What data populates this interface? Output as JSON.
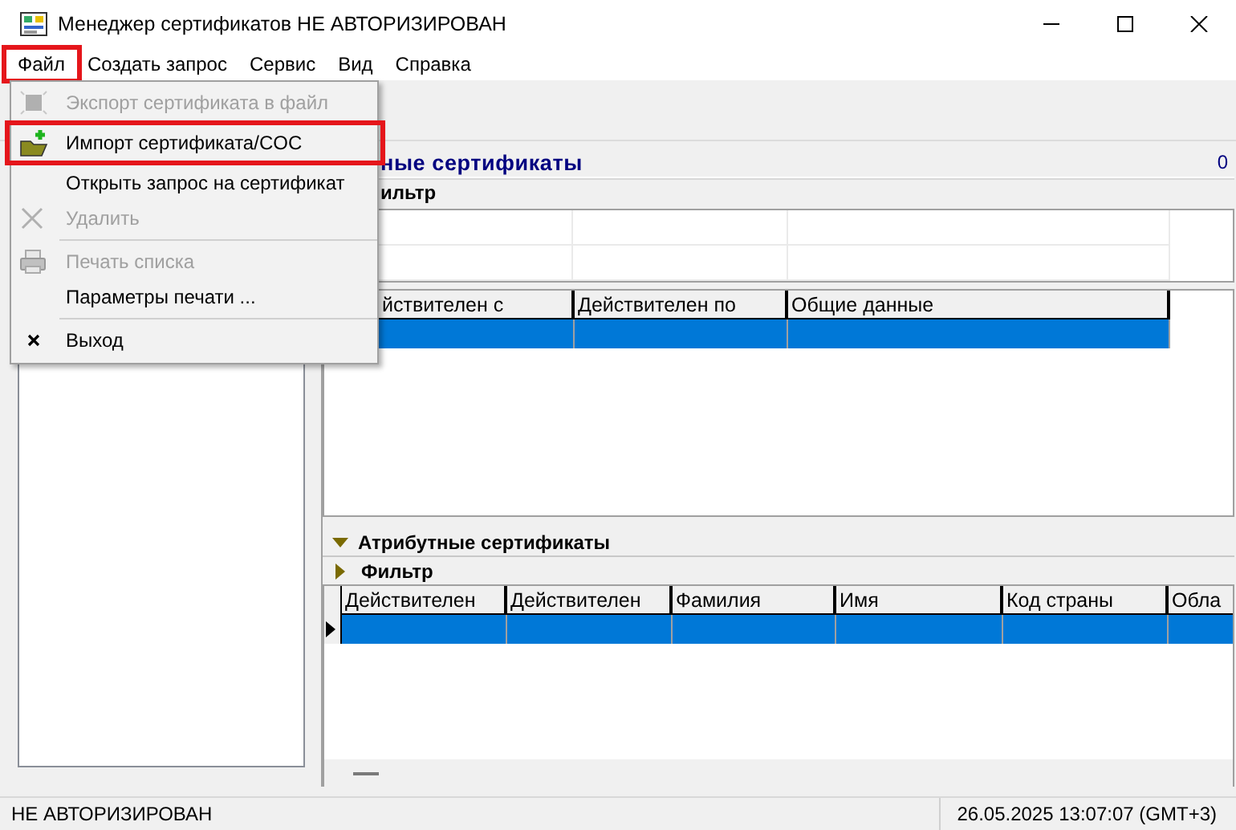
{
  "window": {
    "title": "Менеджер сертификатов  НЕ АВТОРИЗИРОВАН"
  },
  "menu_bar": [
    {
      "label": "Файл",
      "highlighted": true
    },
    {
      "label": "Создать запрос",
      "highlighted": false
    },
    {
      "label": "Сервис",
      "highlighted": false
    },
    {
      "label": "Вид",
      "highlighted": false
    },
    {
      "label": "Справка",
      "highlighted": false
    }
  ],
  "file_menu": {
    "items": [
      {
        "kind": "item",
        "label": "Экспорт сертификата в файл",
        "disabled": true,
        "highlighted": false
      },
      {
        "kind": "item",
        "label": "Импорт сертификата/COC",
        "disabled": false,
        "highlighted": true
      },
      {
        "kind": "item",
        "label": "Открыть запрос на сертификат",
        "disabled": false,
        "highlighted": false
      },
      {
        "kind": "item",
        "label": "Удалить",
        "disabled": true,
        "highlighted": false
      },
      {
        "kind": "separator"
      },
      {
        "kind": "item",
        "label": "Печать списка",
        "disabled": true,
        "highlighted": false
      },
      {
        "kind": "item",
        "label": "Параметры печати ...",
        "disabled": false,
        "highlighted": false
      },
      {
        "kind": "separator"
      },
      {
        "kind": "item",
        "label": "Выход",
        "disabled": false,
        "highlighted": false
      }
    ]
  },
  "certificates_panel": {
    "title": "ные сертификаты",
    "count": "0",
    "filter_label": "ильтр",
    "table": {
      "columns": [
        "йствителен с",
        "Действителен по",
        "Общие данные"
      ],
      "rows": [
        {
          "selected": true
        }
      ]
    }
  },
  "attribute_panel": {
    "title": "Атрибутные сертификаты",
    "expanded": true,
    "filter": {
      "label": "Фильтр",
      "expanded": false
    },
    "table": {
      "columns": [
        "Действителен",
        "Действителен",
        "Фамилия",
        "Имя",
        "Код страны",
        "Обла"
      ],
      "rows": [
        {
          "selected": true
        }
      ]
    }
  },
  "status_bar": {
    "left": "НЕ АВТОРИЗИРОВАН",
    "right": "26.05.2025 13:07:07 (GMT+3)"
  }
}
